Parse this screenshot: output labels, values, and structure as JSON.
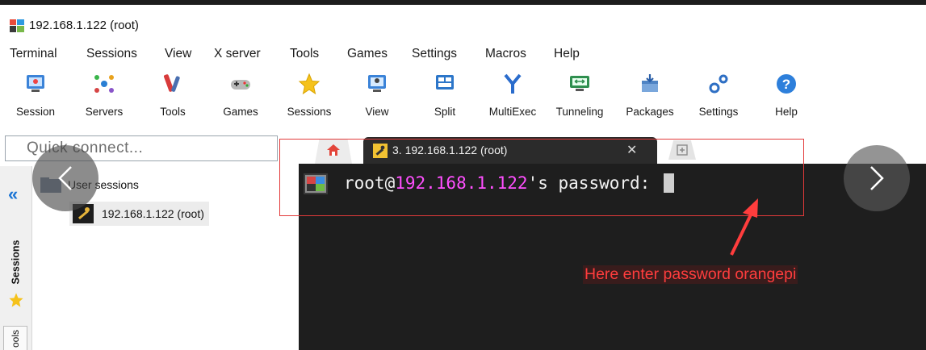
{
  "window": {
    "title": "192.168.1.122 (root)",
    "logo_icon": "mobaxterm-logo-icon"
  },
  "menubar": {
    "items": [
      "Terminal",
      "Sessions",
      "View",
      "X server",
      "Tools",
      "Games",
      "Settings",
      "Macros",
      "Help"
    ]
  },
  "toolbar": {
    "items": [
      {
        "label": "Session",
        "icon": "session-icon"
      },
      {
        "label": "Servers",
        "icon": "servers-icon"
      },
      {
        "label": "Tools",
        "icon": "tools-icon"
      },
      {
        "label": "Games",
        "icon": "games-icon"
      },
      {
        "label": "Sessions",
        "icon": "sessions-star-icon"
      },
      {
        "label": "View",
        "icon": "view-icon"
      },
      {
        "label": "Split",
        "icon": "split-icon"
      },
      {
        "label": "MultiExec",
        "icon": "multiexec-icon"
      },
      {
        "label": "Tunneling",
        "icon": "tunneling-icon"
      },
      {
        "label": "Packages",
        "icon": "packages-icon"
      },
      {
        "label": "Settings",
        "icon": "settings-icon"
      },
      {
        "label": "Help",
        "icon": "help-icon"
      }
    ]
  },
  "quick_connect": {
    "placeholder": "Quick connect..."
  },
  "sidebar": {
    "tabs": [
      "Sessions",
      "ools"
    ],
    "tree": {
      "root_label": "User sessions",
      "items": [
        {
          "label": "192.168.1.122 (root)",
          "icon": "ssh-key-icon"
        }
      ]
    }
  },
  "tabs": {
    "home_icon": "home-icon",
    "active": {
      "label": "3. 192.168.1.122 (root)",
      "close": "✕"
    },
    "new_tab_icon": "new-tab-icon"
  },
  "terminal": {
    "prefix": "root@",
    "host": "192.168.1.122",
    "suffix": "'s password: "
  },
  "annotation": {
    "text": "Here enter password orangepi"
  },
  "colors": {
    "terminal_bg": "#1e1e1e",
    "host_highlight": "#ff4fff",
    "annotation_red": "#ff3d3d",
    "collapse_blue": "#1b74d4"
  }
}
